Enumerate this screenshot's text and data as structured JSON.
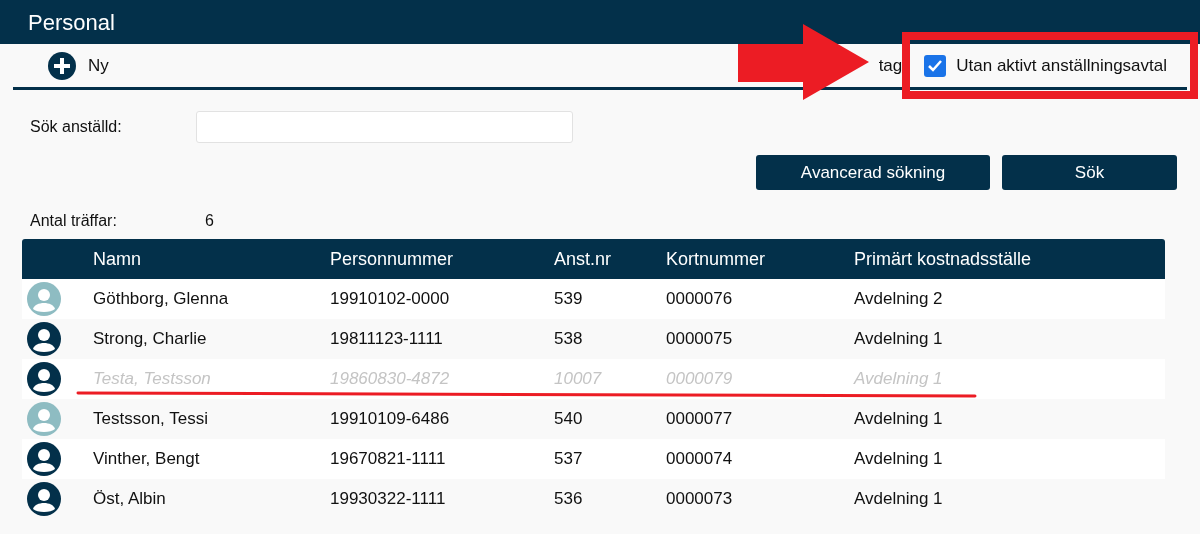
{
  "window": {
    "title": "Personal"
  },
  "toolbar": {
    "new_label": "Ny",
    "partial_label": "tag",
    "filter": {
      "label": "Utan aktivt anställningsavtal",
      "checked": true
    }
  },
  "search": {
    "label": "Sök anställd:"
  },
  "buttons": [
    "Avancerad sökning",
    "Sök"
  ],
  "hits": {
    "label": "Antal träffar:",
    "value": "6"
  },
  "table": {
    "columns": [
      "Namn",
      "Personnummer",
      "Anst.nr",
      "Kortnummer",
      "Primärt kostnadsställe"
    ],
    "rows": [
      {
        "color": "#8ebcc2",
        "inactive": false,
        "cells": [
          "Göthborg, Glenna",
          "19910102-0000",
          "539",
          "0000076",
          "Avdelning 2"
        ]
      },
      {
        "color": "#03304a",
        "inactive": false,
        "cells": [
          "Strong, Charlie",
          "19811123-1111",
          "538",
          "0000075",
          "Avdelning 1"
        ]
      },
      {
        "color": "#03304a",
        "inactive": true,
        "cells": [
          "Testa, Testsson",
          "19860830-4872",
          "10007",
          "0000079",
          "Avdelning 1"
        ]
      },
      {
        "color": "#8ebcc2",
        "inactive": false,
        "cells": [
          "Testsson, Tessi",
          "19910109-6486",
          "540",
          "0000077",
          "Avdelning 1"
        ]
      },
      {
        "color": "#03304a",
        "inactive": false,
        "cells": [
          "Vinther, Bengt",
          "19670821-1111",
          "537",
          "0000074",
          "Avdelning 1"
        ]
      },
      {
        "color": "#03304a",
        "inactive": false,
        "cells": [
          "Öst, Albin",
          "19930322-1111",
          "536",
          "0000073",
          "Avdelning 1"
        ]
      }
    ]
  }
}
